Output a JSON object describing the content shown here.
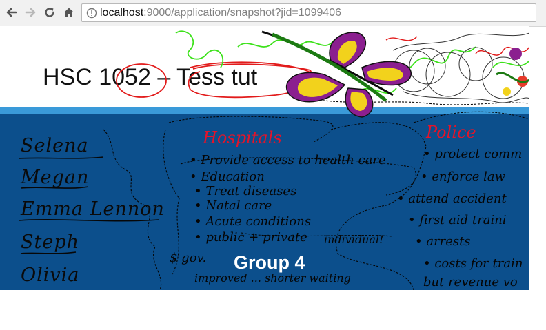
{
  "browser": {
    "url_host": "localhost",
    "url_rest": ":9000/application/snapshot?jid=1099406",
    "icons": [
      "back-arrow-icon",
      "forward-arrow-icon",
      "reload-icon",
      "home-icon",
      "page-icon"
    ]
  },
  "slide": {
    "title": "HSC 1052 – Tess tut",
    "group_label": "Group 4",
    "names": [
      "Selena",
      "Megan",
      "Emma Lennon",
      "Steph",
      "Olivia"
    ],
    "hospitals": {
      "heading": "Hospitals",
      "bullets": [
        "• Provide access to health care",
        "• Education",
        "• Treat diseases",
        "• Natal care",
        "• Acute conditions",
        "• public + private"
      ],
      "extra_notes": [
        "$ gov.",
        "individual!",
        "improved ... shorter waiting"
      ]
    },
    "police": {
      "heading": "Police",
      "bullets": [
        "• protect comm",
        "• enforce law",
        "• attend accident",
        "• first aid traini",
        "• arrests",
        "• costs for train",
        "but revenue vo"
      ]
    },
    "colors": {
      "panel_blue": "#0c4f8c",
      "stripe_blue": "#3a9ad9",
      "heading_red": "#e3142a",
      "doodle_green": "#39e01a",
      "doodle_purple": "#8b1f8f",
      "doodle_yellow": "#f2d21c"
    }
  }
}
